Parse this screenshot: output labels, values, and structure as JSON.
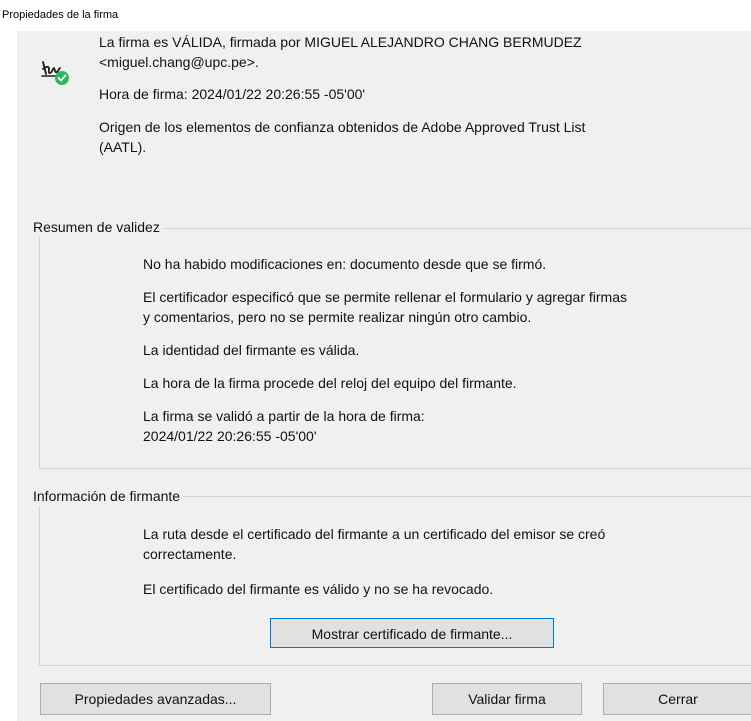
{
  "window": {
    "title": "Propiedades de la firma"
  },
  "summary": {
    "status_line_1": "La firma es VÁLIDA, firmada por MIGUEL ALEJANDRO CHANG BERMUDEZ",
    "status_line_2": "<miguel.chang@upc.pe>.",
    "signing_time": "Hora de firma:  2024/01/22 20:26:55 -05'00'",
    "trust_line_1": "Origen de los elementos de confianza obtenidos de Adobe Approved Trust List",
    "trust_line_2": "(AATL).",
    "icon": "signature-valid-icon",
    "valid_color": "#2fb65a"
  },
  "validity_summary": {
    "legend": "Resumen de validez",
    "items": [
      {
        "lines": [
          "No ha habido modificaciones en: documento desde que se firmó."
        ]
      },
      {
        "lines": [
          "El certificador especificó que se permite rellenar el formulario y agregar firmas",
          "y comentarios, pero no se permite realizar ningún otro cambio."
        ]
      },
      {
        "lines": [
          "La identidad del firmante es válida."
        ]
      },
      {
        "lines": [
          "La hora de la firma procede del reloj del equipo del firmante."
        ]
      },
      {
        "lines": [
          "La firma se validó a partir de la hora de firma:",
          "2024/01/22 20:26:55 -05'00'"
        ]
      }
    ]
  },
  "signer_info": {
    "legend": "Información de firmante",
    "items": [
      {
        "lines": [
          "La ruta desde el certificado del firmante a un certificado del emisor se creó",
          "correctamente."
        ]
      },
      {
        "lines": [
          "El certificado del firmante es válido y no se ha revocado."
        ]
      }
    ],
    "show_certificate_label": "Mostrar certificado de firmante..."
  },
  "footer": {
    "advanced_properties_label": "Propiedades avanzadas...",
    "validate_label": "Validar firma",
    "close_label": "Cerrar"
  }
}
